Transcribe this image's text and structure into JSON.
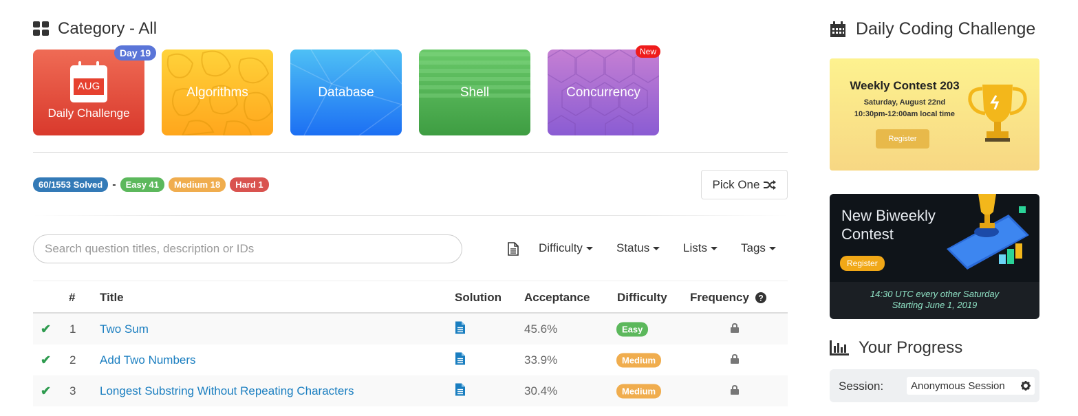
{
  "category": {
    "title": "Category - All",
    "icon": "grid-icon",
    "cards": [
      {
        "label": "Daily Challenge",
        "calendar_month": "AUG",
        "badge": "Day 19"
      },
      {
        "label": "Algorithms"
      },
      {
        "label": "Database"
      },
      {
        "label": "Shell"
      },
      {
        "label": "Concurrency",
        "badge": "New"
      }
    ]
  },
  "stats": {
    "solved": "60/1553 Solved",
    "separator": "-",
    "easy": "Easy 41",
    "medium": "Medium 18",
    "hard": "Hard 1"
  },
  "pick_one": {
    "label": "Pick One",
    "icon": "shuffle-icon"
  },
  "search": {
    "placeholder": "Search question titles, description or IDs",
    "value": ""
  },
  "filters": {
    "difficulty": "Difficulty",
    "status": "Status",
    "lists": "Lists",
    "tags": "Tags"
  },
  "table": {
    "headers": {
      "number": "#",
      "title": "Title",
      "solution": "Solution",
      "acceptance": "Acceptance",
      "difficulty": "Difficulty",
      "frequency": "Frequency"
    },
    "rows": [
      {
        "id": "1",
        "title": "Two Sum",
        "acceptance": "45.6%",
        "difficulty": "Easy"
      },
      {
        "id": "2",
        "title": "Add Two Numbers",
        "acceptance": "33.9%",
        "difficulty": "Medium"
      },
      {
        "id": "3",
        "title": "Longest Substring Without Repeating Characters",
        "acceptance": "30.4%",
        "difficulty": "Medium"
      }
    ]
  },
  "sidebar": {
    "daily_title": "Daily Coding Challenge",
    "weekly": {
      "title": "Weekly Contest 203",
      "date": "Saturday, August 22nd",
      "time": "10:30pm-12:00am local time",
      "register": "Register"
    },
    "biweekly": {
      "title": "New Biweekly Contest",
      "register": "Register",
      "schedule_line1": "14:30 UTC every other Saturday",
      "schedule_line2": "Starting June 1, 2019"
    },
    "progress_title": "Your Progress",
    "session_label": "Session:",
    "session_value": "Anonymous Session"
  },
  "colors": {
    "easy": "#5cb85c",
    "medium": "#f0ad4e",
    "hard": "#d9534f",
    "solved": "#337ab7",
    "link": "#1a7ec0",
    "check": "#2e9b4f"
  }
}
